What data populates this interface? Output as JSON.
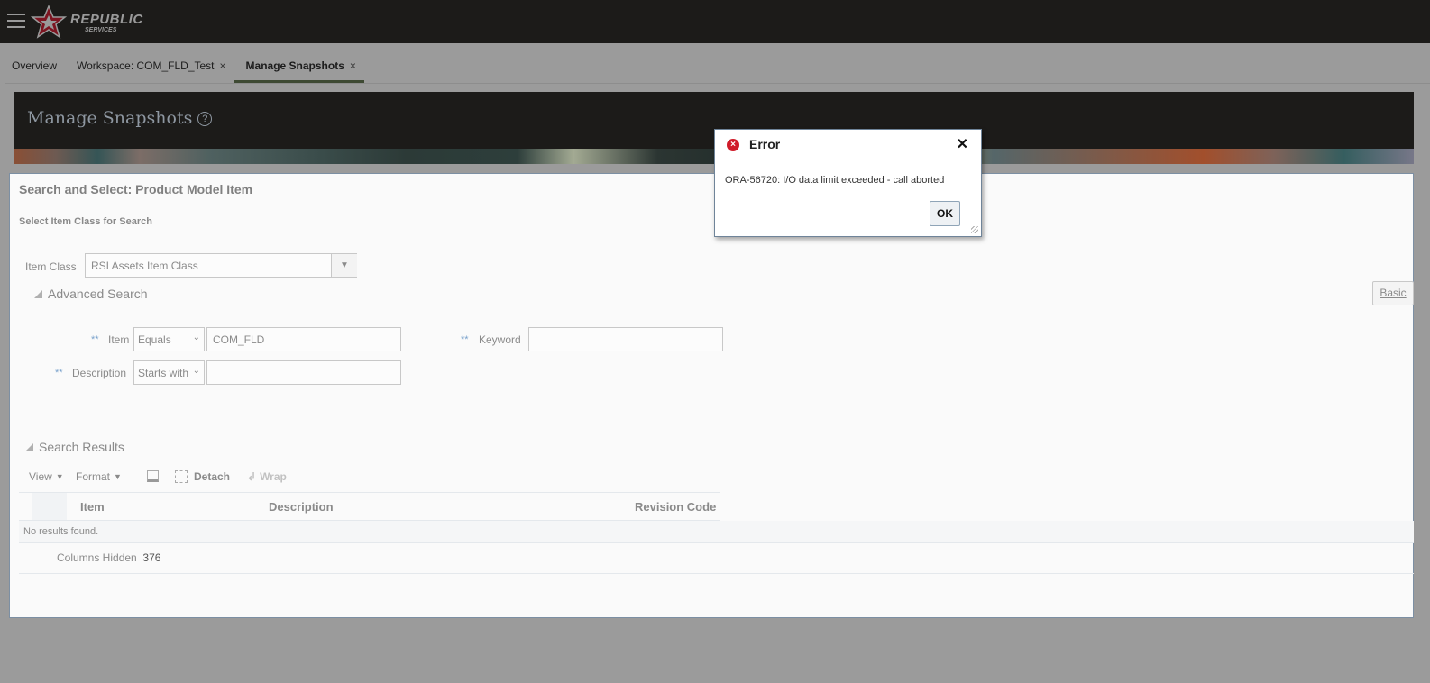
{
  "topbar": {
    "brand_line1": "REPUBLIC",
    "brand_line2": "SERVICES"
  },
  "tabs": [
    {
      "label": "Overview"
    },
    {
      "label": "Workspace: COM_FLD_Test",
      "close": "×"
    },
    {
      "label": "Manage Snapshots",
      "close": "×"
    }
  ],
  "header": {
    "title": "Manage Snapshots",
    "help": "?"
  },
  "search_dialog": {
    "title": "Search and Select: Product Model Item",
    "subtitle": "Select Item Class for Search",
    "item_class_label": "Item Class",
    "item_class_value": "RSI Assets Item Class",
    "advanced_search": "Advanced Search",
    "basic_button": "Basic",
    "req": "**",
    "item_label": "Item",
    "item_operator": "Equals",
    "item_value": "COM_FLD",
    "description_label": "Description",
    "description_operator": "Starts with",
    "description_value": "",
    "keyword_label": "Keyword",
    "keyword_value": "",
    "results_title": "Search Results",
    "toolbar": {
      "view": "View",
      "format": "Format",
      "detach": "Detach",
      "wrap": "Wrap"
    },
    "columns": [
      "Item",
      "Description",
      "Revision Code"
    ],
    "no_results": "No results found.",
    "columns_hidden_label": "Columns Hidden",
    "columns_hidden_count": "376"
  },
  "error_dialog": {
    "title": "Error",
    "message": "ORA-56720: I/O data limit exceeded - call aborted",
    "ok": "OK",
    "close": "✕"
  }
}
